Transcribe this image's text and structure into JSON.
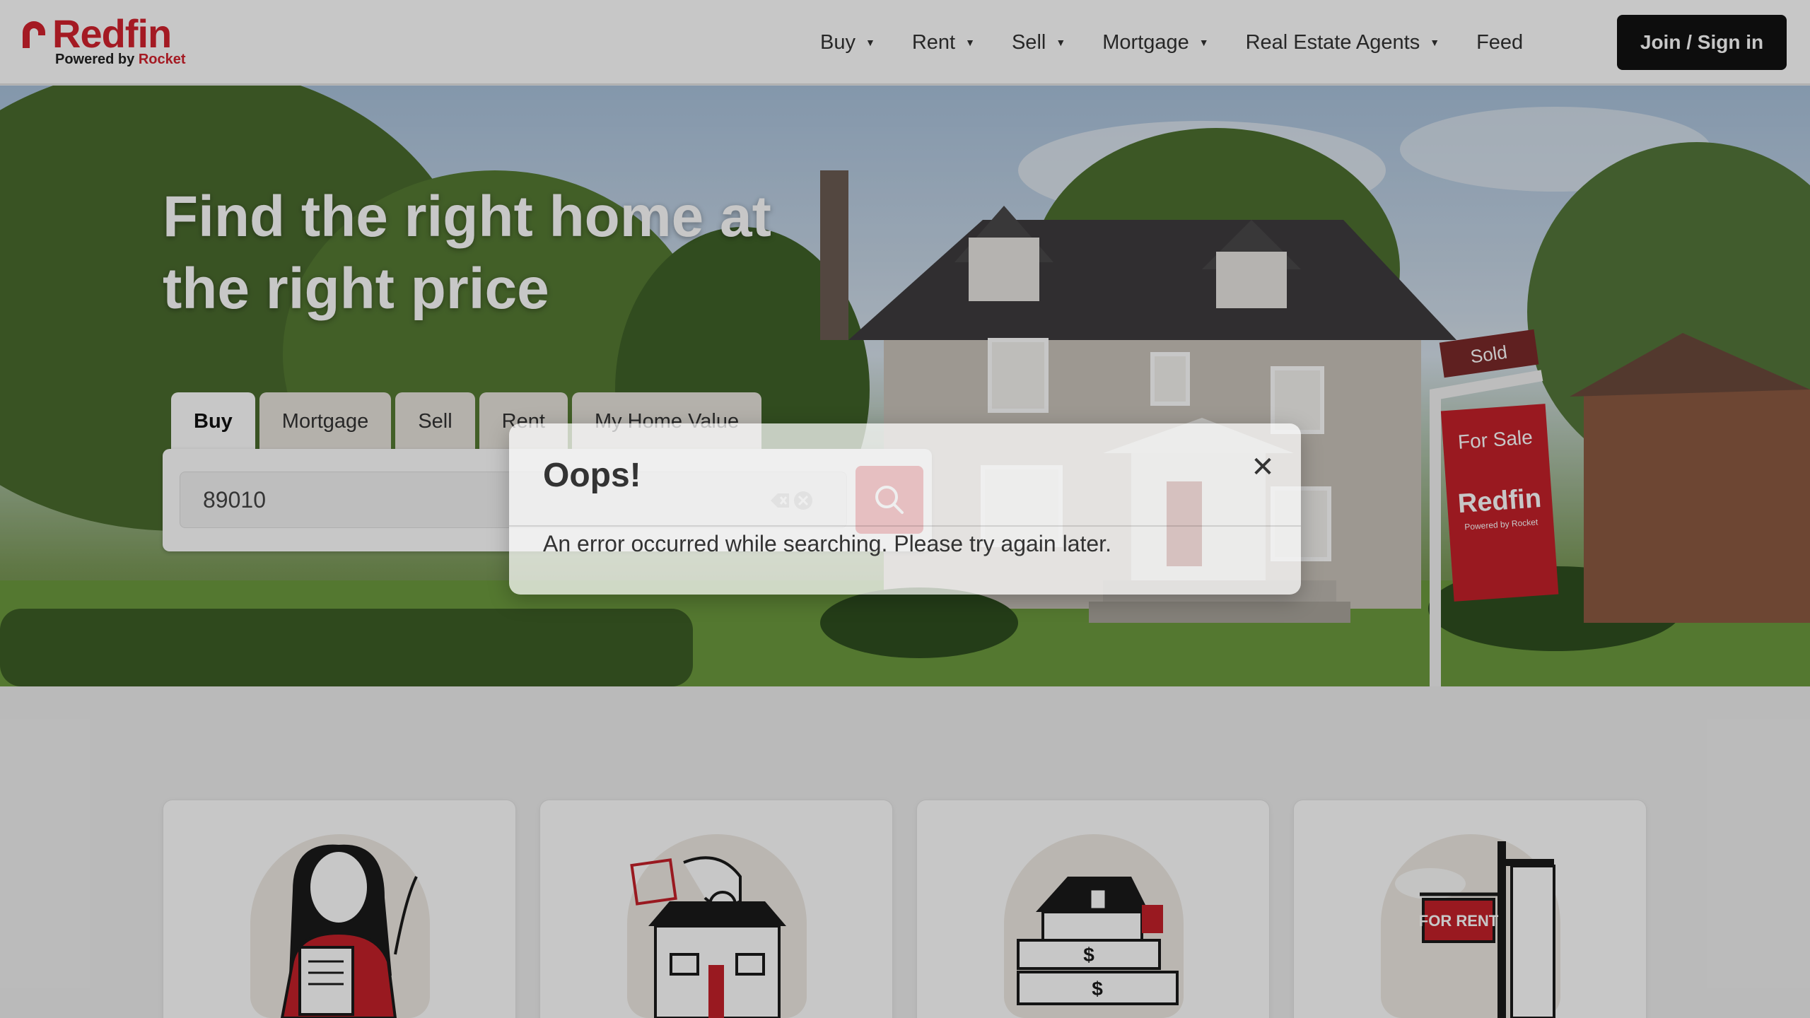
{
  "header": {
    "logo_word": "Redfin",
    "logo_powered": "Powered by",
    "logo_brand": "Rocket",
    "nav": [
      {
        "label": "Buy",
        "has_caret": true
      },
      {
        "label": "Rent",
        "has_caret": true
      },
      {
        "label": "Sell",
        "has_caret": true
      },
      {
        "label": "Mortgage",
        "has_caret": true
      },
      {
        "label": "Real Estate Agents",
        "has_caret": true
      },
      {
        "label": "Feed",
        "has_caret": false
      }
    ],
    "caret_glyph": "▼",
    "join_label": "Join / Sign in"
  },
  "hero": {
    "title": "Find the right home at the right price",
    "sign_sold": "Sold",
    "sign_for_sale": "For Sale",
    "sign_brand": "Redfin",
    "sign_sub": "Powered by Rocket"
  },
  "search": {
    "tabs": [
      {
        "label": "Buy",
        "active": true
      },
      {
        "label": "Mortgage",
        "active": false
      },
      {
        "label": "Sell",
        "active": false
      },
      {
        "label": "Rent",
        "active": false
      },
      {
        "label": "My Home Value",
        "active": false
      }
    ],
    "value": "89010"
  },
  "cards": {
    "for_rent_sign": "FOR RENT"
  },
  "modal": {
    "title": "Oops!",
    "message": "An error occurred while searching. Please try again later.",
    "close_glyph": "✕"
  },
  "colors": {
    "brand": "#d2222d",
    "dark_button": "#111111"
  },
  "icons": [
    "search-icon",
    "close-icon",
    "backspace-icon",
    "clear-icon",
    "chevron-down-icon"
  ]
}
